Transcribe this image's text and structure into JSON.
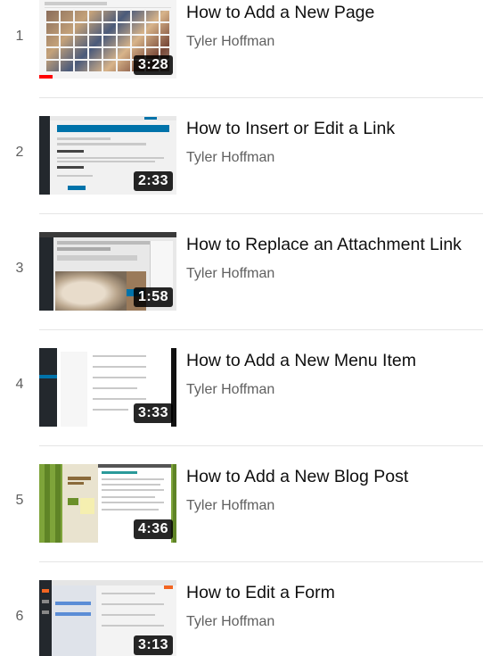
{
  "playlist": {
    "items": [
      {
        "index": "1",
        "title": "How to Add a New Page",
        "channel": "Tyler Hoffman",
        "duration": "3:28",
        "progress": 0.1
      },
      {
        "index": "2",
        "title": "How to Insert or Edit a Link",
        "channel": "Tyler Hoffman",
        "duration": "2:33"
      },
      {
        "index": "3",
        "title": "How to Replace an Attachment Link",
        "channel": "Tyler Hoffman",
        "duration": "1:58"
      },
      {
        "index": "4",
        "title": "How to Add a New Menu Item",
        "channel": "Tyler Hoffman",
        "duration": "3:33"
      },
      {
        "index": "5",
        "title": "How to Add a New Blog Post",
        "channel": "Tyler Hoffman",
        "duration": "4:36"
      },
      {
        "index": "6",
        "title": "How to Edit a Form",
        "channel": "Tyler Hoffman",
        "duration": "3:13"
      }
    ]
  },
  "colors": {
    "progress": "#ff0000",
    "wp_admin_bar": "#23282d",
    "wp_blue": "#0073aa"
  }
}
